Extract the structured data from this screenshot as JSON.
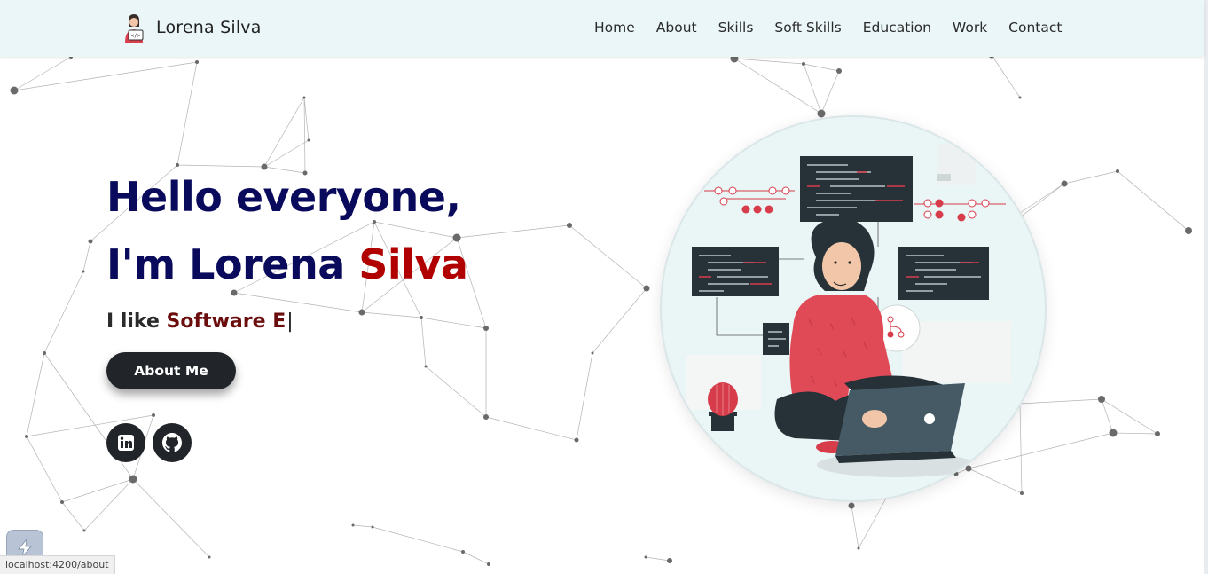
{
  "brand": {
    "name": "Lorena Silva",
    "logo_icon": "developer-avatar-icon"
  },
  "nav": {
    "items": [
      "Home",
      "About",
      "Skills",
      "Soft Skills",
      "Education",
      "Work",
      "Contact"
    ]
  },
  "hero": {
    "greeting": "Hello everyone,",
    "intro_prefix": "I'm Lorena ",
    "intro_accent": "Silva",
    "subtitle_prefix": "I like ",
    "subtitle_typed": "Software E",
    "cursor": "|",
    "about_button": "About Me"
  },
  "social": {
    "linkedin_icon": "linkedin-icon",
    "github_icon": "github-icon"
  },
  "illustration": {
    "icon": "woman-coding-on-laptop-illustration"
  },
  "browser": {
    "status_url": "localhost:4200/about",
    "extension_icon": "lightning-extension-icon"
  },
  "colors": {
    "nav_bg": "#eaf6f8",
    "heading": "#0a0a5c",
    "accent_red": "#b00000",
    "typed_text": "#6b0d0d",
    "button_bg": "#212529"
  }
}
